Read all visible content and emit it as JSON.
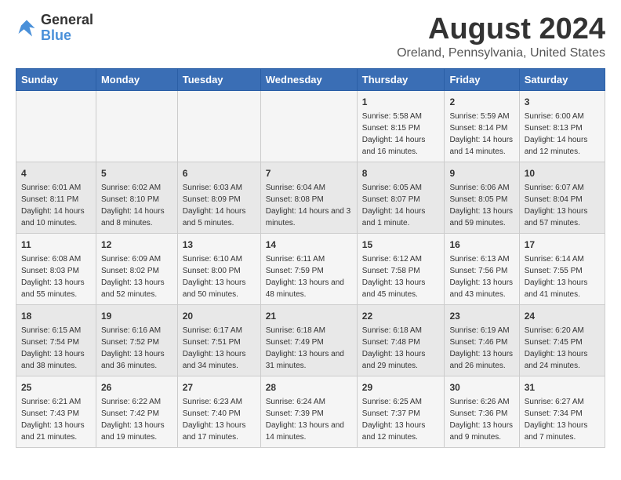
{
  "logo": {
    "general": "General",
    "blue": "Blue"
  },
  "title": "August 2024",
  "subtitle": "Oreland, Pennsylvania, United States",
  "days_of_week": [
    "Sunday",
    "Monday",
    "Tuesday",
    "Wednesday",
    "Thursday",
    "Friday",
    "Saturday"
  ],
  "weeks": [
    [
      {
        "day": "",
        "content": ""
      },
      {
        "day": "",
        "content": ""
      },
      {
        "day": "",
        "content": ""
      },
      {
        "day": "",
        "content": ""
      },
      {
        "day": "1",
        "content": "Sunrise: 5:58 AM\nSunset: 8:15 PM\nDaylight: 14 hours\nand 16 minutes."
      },
      {
        "day": "2",
        "content": "Sunrise: 5:59 AM\nSunset: 8:14 PM\nDaylight: 14 hours\nand 14 minutes."
      },
      {
        "day": "3",
        "content": "Sunrise: 6:00 AM\nSunset: 8:13 PM\nDaylight: 14 hours\nand 12 minutes."
      }
    ],
    [
      {
        "day": "4",
        "content": "Sunrise: 6:01 AM\nSunset: 8:11 PM\nDaylight: 14 hours\nand 10 minutes."
      },
      {
        "day": "5",
        "content": "Sunrise: 6:02 AM\nSunset: 8:10 PM\nDaylight: 14 hours\nand 8 minutes."
      },
      {
        "day": "6",
        "content": "Sunrise: 6:03 AM\nSunset: 8:09 PM\nDaylight: 14 hours\nand 5 minutes."
      },
      {
        "day": "7",
        "content": "Sunrise: 6:04 AM\nSunset: 8:08 PM\nDaylight: 14 hours\nand 3 minutes."
      },
      {
        "day": "8",
        "content": "Sunrise: 6:05 AM\nSunset: 8:07 PM\nDaylight: 14 hours\nand 1 minute."
      },
      {
        "day": "9",
        "content": "Sunrise: 6:06 AM\nSunset: 8:05 PM\nDaylight: 13 hours\nand 59 minutes."
      },
      {
        "day": "10",
        "content": "Sunrise: 6:07 AM\nSunset: 8:04 PM\nDaylight: 13 hours\nand 57 minutes."
      }
    ],
    [
      {
        "day": "11",
        "content": "Sunrise: 6:08 AM\nSunset: 8:03 PM\nDaylight: 13 hours\nand 55 minutes."
      },
      {
        "day": "12",
        "content": "Sunrise: 6:09 AM\nSunset: 8:02 PM\nDaylight: 13 hours\nand 52 minutes."
      },
      {
        "day": "13",
        "content": "Sunrise: 6:10 AM\nSunset: 8:00 PM\nDaylight: 13 hours\nand 50 minutes."
      },
      {
        "day": "14",
        "content": "Sunrise: 6:11 AM\nSunset: 7:59 PM\nDaylight: 13 hours\nand 48 minutes."
      },
      {
        "day": "15",
        "content": "Sunrise: 6:12 AM\nSunset: 7:58 PM\nDaylight: 13 hours\nand 45 minutes."
      },
      {
        "day": "16",
        "content": "Sunrise: 6:13 AM\nSunset: 7:56 PM\nDaylight: 13 hours\nand 43 minutes."
      },
      {
        "day": "17",
        "content": "Sunrise: 6:14 AM\nSunset: 7:55 PM\nDaylight: 13 hours\nand 41 minutes."
      }
    ],
    [
      {
        "day": "18",
        "content": "Sunrise: 6:15 AM\nSunset: 7:54 PM\nDaylight: 13 hours\nand 38 minutes."
      },
      {
        "day": "19",
        "content": "Sunrise: 6:16 AM\nSunset: 7:52 PM\nDaylight: 13 hours\nand 36 minutes."
      },
      {
        "day": "20",
        "content": "Sunrise: 6:17 AM\nSunset: 7:51 PM\nDaylight: 13 hours\nand 34 minutes."
      },
      {
        "day": "21",
        "content": "Sunrise: 6:18 AM\nSunset: 7:49 PM\nDaylight: 13 hours\nand 31 minutes."
      },
      {
        "day": "22",
        "content": "Sunrise: 6:18 AM\nSunset: 7:48 PM\nDaylight: 13 hours\nand 29 minutes."
      },
      {
        "day": "23",
        "content": "Sunrise: 6:19 AM\nSunset: 7:46 PM\nDaylight: 13 hours\nand 26 minutes."
      },
      {
        "day": "24",
        "content": "Sunrise: 6:20 AM\nSunset: 7:45 PM\nDaylight: 13 hours\nand 24 minutes."
      }
    ],
    [
      {
        "day": "25",
        "content": "Sunrise: 6:21 AM\nSunset: 7:43 PM\nDaylight: 13 hours\nand 21 minutes."
      },
      {
        "day": "26",
        "content": "Sunrise: 6:22 AM\nSunset: 7:42 PM\nDaylight: 13 hours\nand 19 minutes."
      },
      {
        "day": "27",
        "content": "Sunrise: 6:23 AM\nSunset: 7:40 PM\nDaylight: 13 hours\nand 17 minutes."
      },
      {
        "day": "28",
        "content": "Sunrise: 6:24 AM\nSunset: 7:39 PM\nDaylight: 13 hours\nand 14 minutes."
      },
      {
        "day": "29",
        "content": "Sunrise: 6:25 AM\nSunset: 7:37 PM\nDaylight: 13 hours\nand 12 minutes."
      },
      {
        "day": "30",
        "content": "Sunrise: 6:26 AM\nSunset: 7:36 PM\nDaylight: 13 hours\nand 9 minutes."
      },
      {
        "day": "31",
        "content": "Sunrise: 6:27 AM\nSunset: 7:34 PM\nDaylight: 13 hours\nand 7 minutes."
      }
    ]
  ]
}
